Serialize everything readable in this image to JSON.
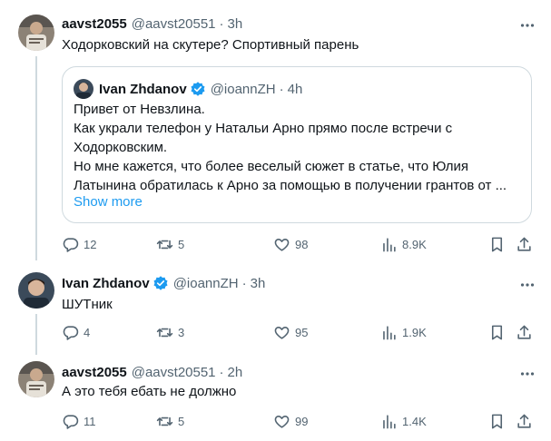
{
  "tweets": [
    {
      "name": "aavst2055",
      "handle": "@aavst20551",
      "time": "3h",
      "verified": false,
      "text": "Ходорковский на скутере? Спортивный парень",
      "quote": {
        "name": "Ivan Zhdanov",
        "handle": "@ioannZH",
        "time": "4h",
        "lines": [
          "Привет от Невзлина.",
          "Как украли телефон у Натальи Арно прямо после встречи с",
          "Ходорковским.",
          "Но мне кажется, что более веселый сюжет в статье, что Юлия",
          "Латынина обратилась к Арно за помощью в получении  грантов от ..."
        ],
        "show_more": "Show more"
      },
      "stats": {
        "replies": "12",
        "reposts": "5",
        "likes": "98",
        "views": "8.9K"
      }
    },
    {
      "name": "Ivan Zhdanov",
      "handle": "@ioannZH",
      "time": "3h",
      "verified": true,
      "text": "ШУТник",
      "stats": {
        "replies": "4",
        "reposts": "3",
        "likes": "95",
        "views": "1.9K"
      }
    },
    {
      "name": "aavst2055",
      "handle": "@aavst20551",
      "time": "2h",
      "verified": false,
      "text": "А это тебя ебать не должно",
      "stats": {
        "replies": "11",
        "reposts": "5",
        "likes": "99",
        "views": "1.4K"
      }
    }
  ],
  "colors": {
    "text": "#0f1419",
    "secondary": "#536471",
    "link": "#1d9bf0",
    "verified": "#1d9bf0",
    "border": "#cfd9de"
  },
  "dot": "·",
  "icons": [
    "more-icon",
    "verified-badge-icon",
    "reply-icon",
    "repost-icon",
    "like-icon",
    "views-icon",
    "bookmark-icon",
    "share-icon"
  ]
}
